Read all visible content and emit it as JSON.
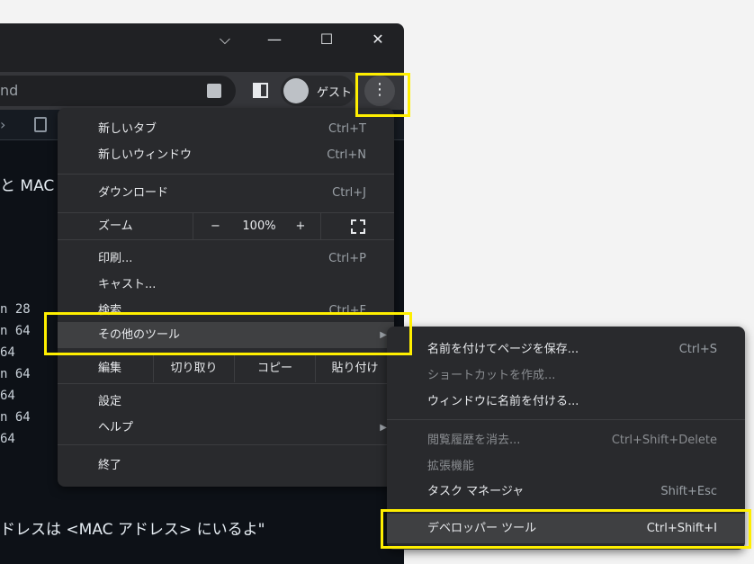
{
  "window": {
    "controls": {
      "tabsearch": "⌵",
      "minimize": "—",
      "maximize": "☐",
      "close": "✕"
    }
  },
  "toolbar": {
    "omnibox_text": "nd",
    "profile_label": "ゲスト"
  },
  "page": {
    "heading_fragment": "と MAC",
    "code_lines": [
      "n 28",
      "n 64",
      "64",
      "n 64",
      "64",
      "n 64",
      "64"
    ],
    "bottom_text": "ドレスは <MAC アドレス> にいるよ\""
  },
  "menu": {
    "new_tab": {
      "label": "新しいタブ",
      "shortcut": "Ctrl+T"
    },
    "new_window": {
      "label": "新しいウィンドウ",
      "shortcut": "Ctrl+N"
    },
    "downloads": {
      "label": "ダウンロード",
      "shortcut": "Ctrl+J"
    },
    "zoom": {
      "label": "ズーム",
      "minus": "−",
      "value": "100%",
      "plus": "+"
    },
    "print": {
      "label": "印刷...",
      "shortcut": "Ctrl+P"
    },
    "cast": {
      "label": "キャスト..."
    },
    "find": {
      "label": "検索",
      "shortcut": "Ctrl+F"
    },
    "more_tools": {
      "label": "その他のツール"
    },
    "edit": {
      "label": "編集",
      "cut": "切り取り",
      "copy": "コピー",
      "paste": "貼り付け"
    },
    "settings": {
      "label": "設定"
    },
    "help": {
      "label": "ヘルプ"
    },
    "exit": {
      "label": "終了"
    }
  },
  "submenu": {
    "save_page": {
      "label": "名前を付けてページを保存...",
      "shortcut": "Ctrl+S"
    },
    "create_shortcut": {
      "label": "ショートカットを作成..."
    },
    "name_window": {
      "label": "ウィンドウに名前を付ける..."
    },
    "clear_data": {
      "label": "閲覧履歴を消去...",
      "shortcut": "Ctrl+Shift+Delete"
    },
    "extensions": {
      "label": "拡張機能"
    },
    "task_manager": {
      "label": "タスク マネージャ",
      "shortcut": "Shift+Esc"
    },
    "devtools": {
      "label": "デベロッパー ツール",
      "shortcut": "Ctrl+Shift+I"
    }
  },
  "colors": {
    "highlight": "#ffef00",
    "menu_bg": "#292a2d"
  }
}
